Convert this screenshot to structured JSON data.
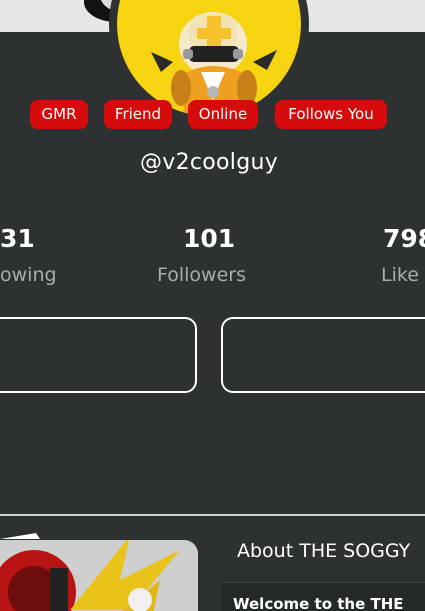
{
  "profile": {
    "handle": "@v2coolguy",
    "avatar_icon": "plush-toy-avatar",
    "badges": [
      "GMR",
      "Friend",
      "Online",
      "Follows You"
    ],
    "badge_color": "#d60c0c"
  },
  "stats": {
    "following": {
      "value": "31",
      "label": "owing"
    },
    "followers": {
      "value": "101",
      "label": "Followers"
    },
    "likes": {
      "value": "798",
      "label": "Like"
    }
  },
  "about": {
    "title": "About THE SOGGY",
    "text": "Welcome to the THE"
  },
  "colors": {
    "background": "#2d3131",
    "banner": "#e7e7e7",
    "avatar_bg": "#f7d411",
    "text": "#ffffff",
    "muted_text": "#a9acac"
  }
}
